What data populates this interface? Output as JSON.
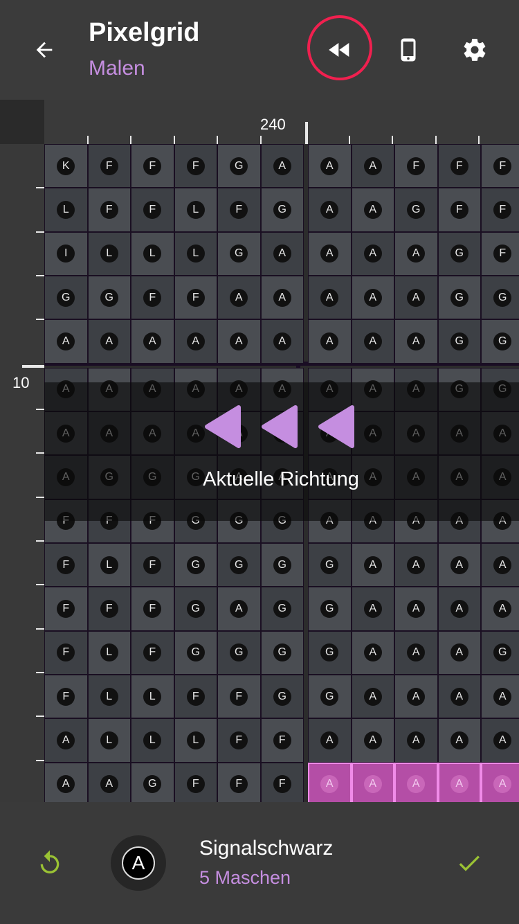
{
  "header": {
    "title": "Pixelgrid",
    "subtitle": "Malen",
    "icons": [
      "back-arrow-icon",
      "rewind-icon",
      "phone-icon",
      "gear-icon"
    ]
  },
  "ruler": {
    "top_label": "240",
    "left_label": "10"
  },
  "grid": {
    "rows": [
      [
        "K",
        "F",
        "F",
        "F",
        "G",
        "A",
        "A",
        "A",
        "F",
        "F",
        "F"
      ],
      [
        "L",
        "F",
        "F",
        "L",
        "F",
        "G",
        "A",
        "A",
        "G",
        "F",
        "F"
      ],
      [
        "I",
        "L",
        "L",
        "L",
        "G",
        "A",
        "A",
        "A",
        "A",
        "G",
        "F"
      ],
      [
        "G",
        "G",
        "F",
        "F",
        "A",
        "A",
        "A",
        "A",
        "A",
        "G",
        "G"
      ],
      [
        "A",
        "A",
        "A",
        "A",
        "A",
        "A",
        "A",
        "A",
        "A",
        "G",
        "G"
      ],
      [
        "A",
        "A",
        "A",
        "A",
        "A",
        "A",
        "A",
        "A",
        "A",
        "G",
        "G"
      ],
      [
        "A",
        "A",
        "A",
        "A",
        "A",
        "A",
        "A",
        "A",
        "A",
        "A",
        "A"
      ],
      [
        "A",
        "G",
        "G",
        "G",
        "A",
        "A",
        "A",
        "A",
        "A",
        "A",
        "A"
      ],
      [
        "F",
        "F",
        "F",
        "G",
        "G",
        "G",
        "A",
        "A",
        "A",
        "A",
        "A"
      ],
      [
        "F",
        "L",
        "F",
        "G",
        "G",
        "G",
        "G",
        "A",
        "A",
        "A",
        "A"
      ],
      [
        "F",
        "F",
        "F",
        "G",
        "A",
        "G",
        "G",
        "A",
        "A",
        "A",
        "A"
      ],
      [
        "F",
        "L",
        "F",
        "G",
        "G",
        "G",
        "G",
        "A",
        "A",
        "A",
        "G"
      ],
      [
        "F",
        "L",
        "L",
        "F",
        "F",
        "G",
        "G",
        "A",
        "A",
        "A",
        "A"
      ],
      [
        "A",
        "L",
        "L",
        "L",
        "F",
        "F",
        "A",
        "A",
        "A",
        "A",
        "A"
      ],
      [
        "A",
        "A",
        "G",
        "F",
        "F",
        "F",
        "A",
        "A",
        "A",
        "A",
        "A"
      ]
    ],
    "highlight_row": 14,
    "highlight_from_col": 6,
    "highlight_color": "#b44ea6"
  },
  "overlay": {
    "text": "Aktuelle Richtung",
    "arrow_color": "#c58ee0"
  },
  "bottom": {
    "color_letter": "A",
    "color_name": "Signalschwarz",
    "count": "5 Maschen",
    "accent": "#9ac234"
  }
}
